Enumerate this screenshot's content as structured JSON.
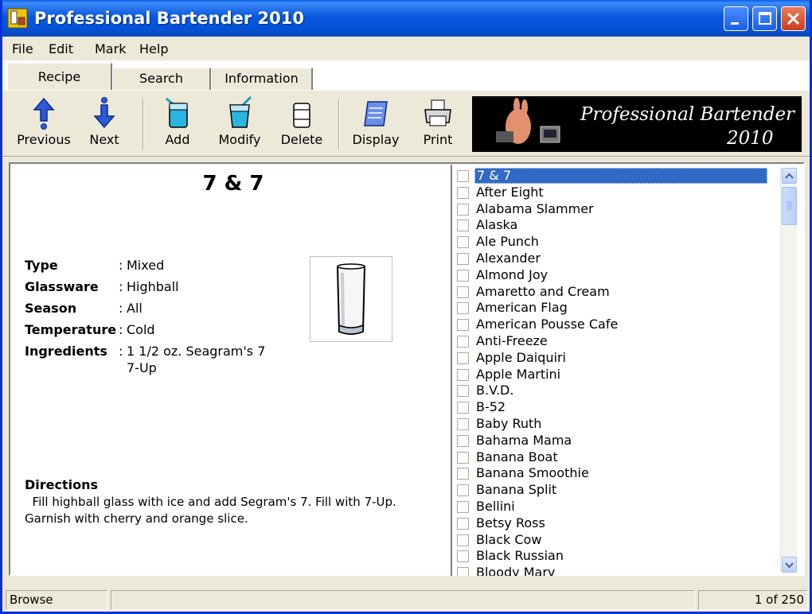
{
  "window": {
    "title": "Professional Bartender 2010"
  },
  "menu": [
    "File",
    "Edit",
    "Mark",
    "Help"
  ],
  "tabs": [
    "Recipe",
    "Search",
    "Information"
  ],
  "toolbar": {
    "previous": "Previous",
    "next": "Next",
    "add": "Add",
    "modify": "Modify",
    "delete": "Delete",
    "display": "Display",
    "print": "Print"
  },
  "banner": {
    "line1": "Professional Bartender",
    "line2": "2010"
  },
  "recipe": {
    "title": "7 & 7",
    "fields": [
      {
        "label": "Type",
        "value": "Mixed"
      },
      {
        "label": "Glassware",
        "value": "Highball"
      },
      {
        "label": "Season",
        "value": "All"
      },
      {
        "label": "Temperature",
        "value": "Cold"
      },
      {
        "label": "Ingredients",
        "value": "1 1/2 oz. Seagram's 7",
        "value2": "7-Up"
      }
    ],
    "colon": ":",
    "directions_label": "Directions",
    "directions_text": "Fill highball glass with ice and add Segram's 7.  Fill with 7-Up.  Garnish with cherry and orange slice."
  },
  "drinks": [
    "7 & 7",
    "After Eight",
    "Alabama Slammer",
    "Alaska",
    "Ale Punch",
    "Alexander",
    "Almond Joy",
    "Amaretto and Cream",
    "American Flag",
    "American Pousse Cafe",
    "Anti-Freeze",
    "Apple Daiquiri",
    "Apple Martini",
    "B.V.D.",
    "B-52",
    "Baby Ruth",
    "Bahama Mama",
    "Banana Boat",
    "Banana Smoothie",
    "Banana Split",
    "Bellini",
    "Betsy Ross",
    "Black Cow",
    "Black Russian",
    "Bloody Mary"
  ],
  "selected_index": 0,
  "status": {
    "mode": "Browse",
    "middle": "",
    "count": "1 of 250"
  },
  "colors": {
    "titlebar": "#0452d6",
    "selection": "#316ac5",
    "chrome": "#ece9d8",
    "icon_blue": "#2a5bd7"
  }
}
